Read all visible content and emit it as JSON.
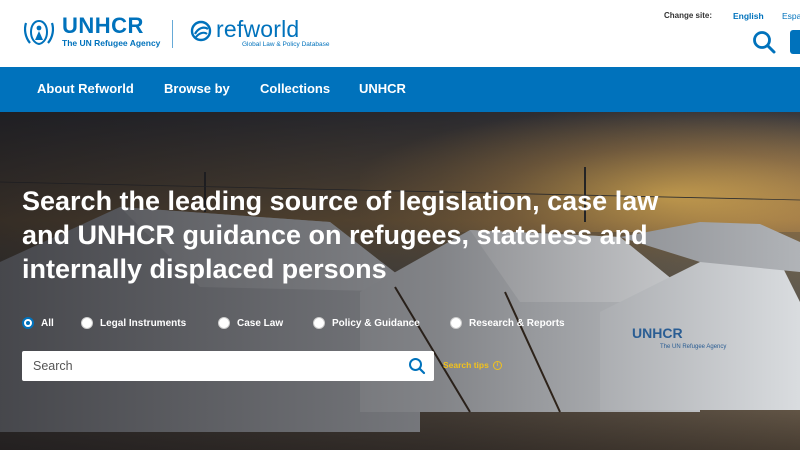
{
  "header": {
    "unhcr_name": "UNHCR",
    "unhcr_tagline": "The UN Refugee Agency",
    "refworld_name": "refworld",
    "refworld_tagline": "Global Law & Policy Database",
    "change_site_label": "Change site:",
    "languages": [
      "English",
      "Espa"
    ],
    "search_icon": "search-icon",
    "account_icon": "account-icon"
  },
  "nav": {
    "items": [
      "About Refworld",
      "Browse by",
      "Collections",
      "UNHCR"
    ]
  },
  "hero": {
    "headline": "Search the leading source of legislation, case law and UNHCR guidance on refugees, stateless and internally displaced persons",
    "tent_label": "UNHCR",
    "tent_sub": "The UN Refugee Agency"
  },
  "filters": {
    "options": [
      "All",
      "Legal Instruments",
      "Case Law",
      "Policy & Guidance",
      "Research & Reports"
    ],
    "selected": "All"
  },
  "search": {
    "placeholder": "Search",
    "tips_label": "Search tips"
  },
  "colors": {
    "brand_blue": "#0072bc",
    "tips_yellow": "#f2c21b"
  }
}
